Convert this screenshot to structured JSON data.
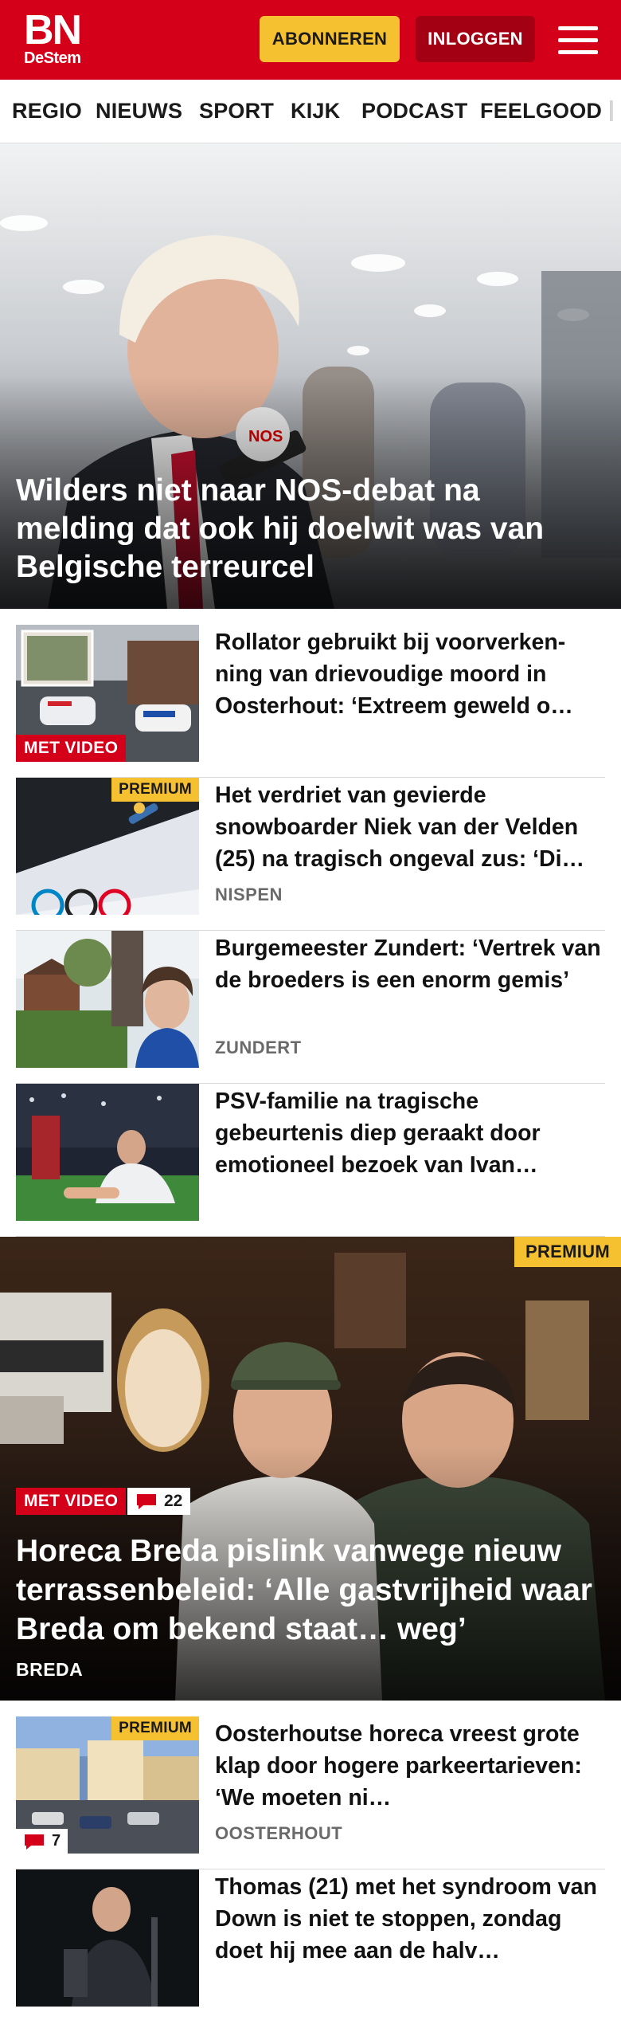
{
  "header": {
    "logo_main": "BN",
    "logo_sub": "DeStem",
    "subscribe_label": "ABONNEREN",
    "login_label": "INLOGGEN",
    "brand_color": "#d4001a",
    "subscribe_color": "#f6c130"
  },
  "nav": {
    "items": [
      "REGIO",
      "NIEUWS",
      "SPORT",
      "KIJK",
      "PODCAST",
      "FEELGOOD"
    ]
  },
  "hero": {
    "title": "Wilders niet naar NOS-debat na melding dat ook hij doelwit was van Belgische terreurcel",
    "mic_label": "NOS"
  },
  "articles": [
    {
      "title": "Rollator gebruikt bij voorverken­ning van drievoudige moord in Oosterhout: ‘Extreem geweld o…",
      "badge": "MET VIDEO"
    },
    {
      "title": "Het verdriet van gevierde snowboarder Niek van der Velden (25) na tragisch ongeval zus: ‘Di…",
      "badge": "PREMIUM",
      "place": "NISPEN"
    },
    {
      "title": "Burgemeester Zundert: ‘Vertrek van de broeders is een enorm gemis’",
      "place": "ZUNDERT"
    },
    {
      "title": "PSV-familie na tragische gebeurtenis diep geraakt door emotioneel bezoek van Ivan…"
    }
  ],
  "feature": {
    "title": "Horeca Breda pislink vanwege nieuw terrassenbeleid: ‘Alle gastvrijheid waar Breda om bekend staat… weg’",
    "place": "BREDA",
    "badge_premium": "PREMIUM",
    "badge_video": "MET VIDEO",
    "comments": "22"
  },
  "articles2": [
    {
      "title": "Oosterhoutse horeca vreest grote klap door hogere parkeertarieven: ‘We moeten ni…",
      "badge": "PREMIUM",
      "place": "OOSTERHOUT",
      "comments": "7"
    },
    {
      "title": "Thomas (21) met het syndroom van Down is niet te stoppen, zondag doet hij mee aan de halv…"
    }
  ]
}
